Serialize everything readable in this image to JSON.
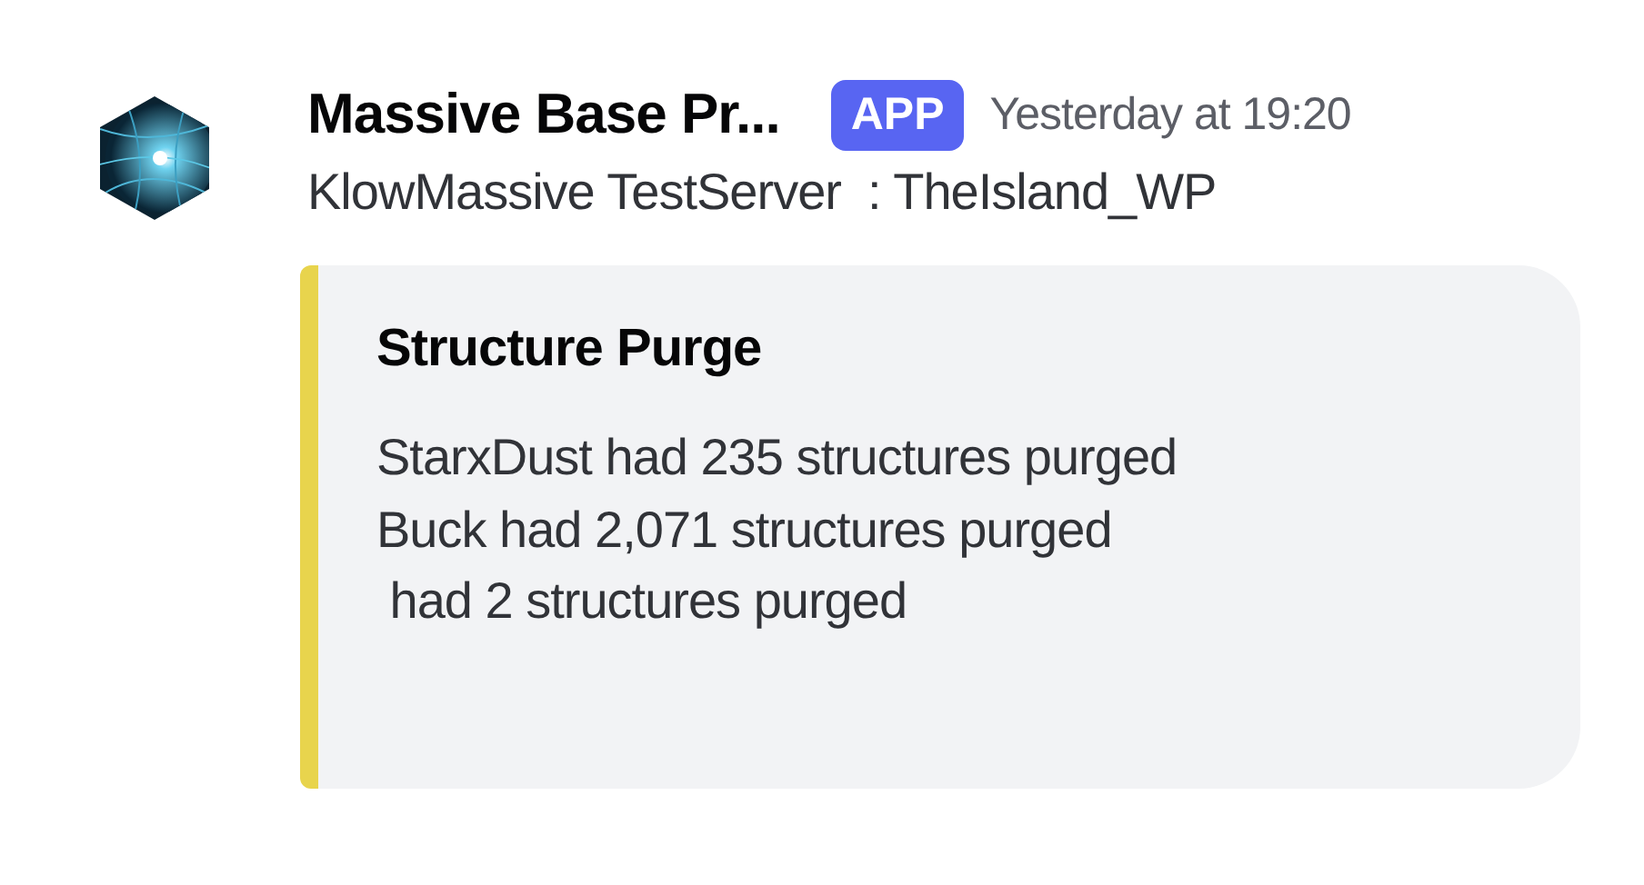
{
  "message": {
    "author": "Massive Base Pr...",
    "badge": "APP",
    "timestamp": "Yesterday at 19:20",
    "text": "KlowMassive TestServer  : TheIsland_WP"
  },
  "embed": {
    "color": "#e8d44d",
    "title": "Structure Purge",
    "lines": [
      "StarxDust had 235 structures purged",
      "Buck had 2,071 structures purged",
      " had 2 structures purged"
    ]
  }
}
